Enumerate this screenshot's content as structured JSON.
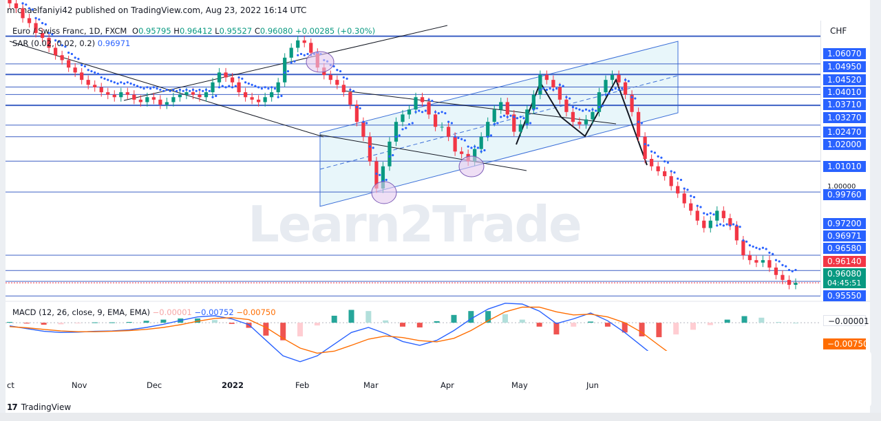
{
  "header": {
    "publish_text": "michaelfaniyi42 published on TradingView.com, Aug 23, 2022 16:14 UTC"
  },
  "legend": {
    "symbol": "Euro / Swiss Franc, 1D, FXCM",
    "open_label": "O",
    "open": "0.95795",
    "high_label": "H",
    "high": "0.96412",
    "low_label": "L",
    "low": "0.95527",
    "close_label": "C",
    "close": "0.96080",
    "change": "+0.00285 (+0.30%)",
    "sar_label": "SAR (0.02, 0.02, 0.2)",
    "sar_value": "0.96971",
    "macd_label": "MACD (12, 26, close, 9, EMA, EMA)",
    "macd_hist": "−0.00001",
    "macd_line": "−0.00752",
    "macd_signal": "−0.00750"
  },
  "price_axis": {
    "currency": "CHF",
    "tags": [
      "1.06070",
      "1.04950",
      "1.04520",
      "1.04010",
      "1.03710",
      "1.03270",
      "1.02470",
      "1.02000",
      "1.01010",
      "0.99760",
      "0.97200",
      "0.96971",
      "0.96580",
      "0.96140",
      "0.96080",
      "0.95550"
    ],
    "plain_tag": "1.00000",
    "countdown": "04:45:51",
    "macd_tags": [
      "−0.00001",
      "−0.00750"
    ]
  },
  "time_axis": {
    "labels": [
      "ct",
      "Nov",
      "Dec",
      "2022",
      "Feb",
      "Mar",
      "Apr",
      "May",
      "Jun"
    ]
  },
  "watermark": "Learn2Trade",
  "footer": {
    "brand": "TradingView",
    "logo_mark": "17"
  },
  "colors": {
    "bull": "#089981",
    "bear": "#f23645",
    "accent": "#2962ff",
    "signal": "#ff6d00",
    "channel_fill": "#d6eef5"
  },
  "chart_data": [
    {
      "type": "line",
      "title": "Euro / Swiss Franc, 1D, FXCM",
      "xlabel": "",
      "ylabel": "",
      "x_labels": [
        "ct",
        "Nov",
        "Dec",
        "2022",
        "Feb",
        "Mar",
        "Apr",
        "May",
        "Jun"
      ],
      "ylim": [
        0.955,
        1.067
      ],
      "grid": false,
      "horizontal_levels": [
        1.0607,
        1.0495,
        1.0452,
        1.0401,
        1.0371,
        1.0327,
        1.0247,
        1.02,
        1.0101,
        0.9976,
        0.972,
        0.9658,
        0.9614,
        0.9555
      ],
      "series": [
        {
          "name": "",
          "values": [
            1.074,
            1.072,
            1.068,
            1.066,
            1.062,
            1.06,
            1.056,
            1.053,
            1.051,
            1.048,
            1.046,
            1.043,
            1.041,
            1.04,
            1.038,
            1.037,
            1.036,
            1.038,
            1.037,
            1.035,
            1.034,
            1.036,
            1.035,
            1.033,
            1.034,
            1.036,
            1.037,
            1.038,
            1.037,
            1.036,
            1.038,
            1.042,
            1.046,
            1.044,
            1.042,
            1.038,
            1.036,
            1.035,
            1.034,
            1.036,
            1.038,
            1.042,
            1.052,
            1.056,
            1.059,
            1.058,
            1.054,
            1.048,
            1.045,
            1.043,
            1.041,
            1.038,
            1.033,
            1.026,
            1.02,
            1.01,
            0.999,
            1.008,
            1.018,
            1.026,
            1.029,
            1.031,
            1.036,
            1.034,
            1.029,
            1.024,
            1.024,
            1.02,
            1.014,
            1.013,
            1.01,
            1.015,
            1.02,
            1.026,
            1.031,
            1.034,
            1.029,
            1.022,
            1.025,
            1.031,
            1.037,
            1.045,
            1.043,
            1.04,
            1.035,
            1.03,
            1.026,
            1.025,
            1.027,
            1.03,
            1.038,
            1.043,
            1.045,
            1.042,
            1.037,
            1.03,
            1.02,
            1.011,
            1.008,
            1.006,
            1.004,
            1.0,
            0.997,
            0.993,
            0.99,
            0.986,
            0.983,
            0.986,
            0.99,
            0.987,
            0.984,
            0.978,
            0.972,
            0.97,
            0.969,
            0.97,
            0.967,
            0.964,
            0.962,
            0.96,
            0.9608
          ]
        }
      ]
    },
    {
      "type": "line",
      "title": "MACD (12, 26, close, 9, EMA, EMA)",
      "xlabel": "",
      "ylabel": "",
      "ylim": [
        -0.0125,
        0.0055
      ],
      "series": [
        {
          "name": "MACD",
          "values": [
            -0.0008,
            -0.0015,
            -0.0022,
            -0.0025,
            -0.0024,
            -0.0022,
            -0.0021,
            -0.0018,
            -0.0012,
            -0.0004,
            0.0006,
            0.0015,
            0.0018,
            0.001,
            -0.0005,
            -0.0045,
            -0.0085,
            -0.01,
            -0.0085,
            -0.0055,
            -0.0025,
            -0.0012,
            -0.0028,
            -0.0048,
            -0.0058,
            -0.0045,
            -0.002,
            0.001,
            0.0035,
            0.005,
            0.0048,
            0.003,
            -0.0002,
            0.001,
            0.0025,
            0.0005,
            -0.0025,
            -0.006,
            -0.0095,
            -0.012,
            -0.013,
            -0.0128,
            -0.011,
            -0.0085,
            -0.0075,
            -0.0078,
            -0.0075
          ]
        },
        {
          "name": "Signal",
          "values": [
            -0.001,
            -0.0013,
            -0.0017,
            -0.0021,
            -0.0023,
            -0.0023,
            -0.0022,
            -0.002,
            -0.0017,
            -0.0012,
            -0.0005,
            0.0004,
            0.0011,
            0.0013,
            0.0008,
            -0.0012,
            -0.004,
            -0.0065,
            -0.0078,
            -0.0073,
            -0.0058,
            -0.0042,
            -0.0034,
            -0.0038,
            -0.0046,
            -0.0049,
            -0.004,
            -0.002,
            0.0005,
            0.0028,
            0.004,
            0.004,
            0.0028,
            0.002,
            0.0022,
            0.0015,
            0.0,
            -0.0025,
            -0.0058,
            -0.009,
            -0.0112,
            -0.0122,
            -0.0118,
            -0.0102,
            -0.0088,
            -0.008,
            -0.0075
          ]
        }
      ]
    }
  ]
}
